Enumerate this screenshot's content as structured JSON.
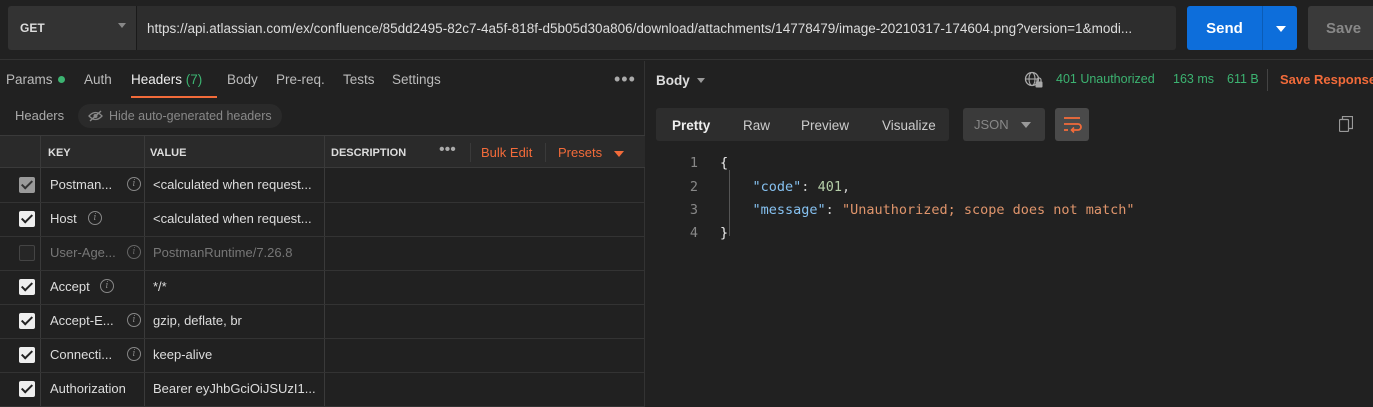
{
  "request": {
    "method": "GET",
    "url": "https://api.atlassian.com/ex/confluence/85dd2495-82c7-4a5f-818f-d5b05d30a806/download/attachments/14778479/image-20210317-174604.png?version=1&modi...",
    "send_label": "Send",
    "save_label": "Save"
  },
  "request_tabs": [
    {
      "label": "Params"
    },
    {
      "label": "Auth"
    },
    {
      "label": "Headers",
      "count": "(7)"
    },
    {
      "label": "Body"
    },
    {
      "label": "Pre-req."
    },
    {
      "label": "Tests"
    },
    {
      "label": "Settings"
    }
  ],
  "headers_section": {
    "label": "Headers",
    "hide_auto_label": "Hide auto-generated headers"
  },
  "table": {
    "columns": {
      "key": "KEY",
      "value": "VALUE",
      "description": "DESCRIPTION"
    },
    "bulk_edit": "Bulk Edit",
    "presets": "Presets",
    "rows": [
      {
        "key": "Postman...",
        "value": "<calculated when request...",
        "state": "gray"
      },
      {
        "key": "Host",
        "value": "<calculated when request...",
        "state": "on"
      },
      {
        "key": "User-Age...",
        "value": "PostmanRuntime/7.26.8",
        "state": "off"
      },
      {
        "key": "Accept",
        "value": "*/*",
        "state": "on"
      },
      {
        "key": "Accept-E...",
        "value": "gzip, deflate, br",
        "state": "on"
      },
      {
        "key": "Connecti...",
        "value": "keep-alive",
        "state": "on"
      },
      {
        "key": "Authorization",
        "value": "Bearer eyJhbGciOiJSUzI1...",
        "state": "on"
      }
    ]
  },
  "response": {
    "body_label": "Body",
    "status": "401 Unauthorized",
    "time": "163 ms",
    "size": "611 B",
    "save_response": "Save Response",
    "view_tabs": [
      "Pretty",
      "Raw",
      "Preview",
      "Visualize"
    ],
    "format": "JSON",
    "code_lines": [
      {
        "num": "1",
        "text": "{"
      },
      {
        "num": "2",
        "key": "\"code\"",
        "value": "401",
        "trail": ","
      },
      {
        "num": "3",
        "key": "\"message\"",
        "value": "\"Unauthorized; scope does not match\"",
        "trail": ""
      },
      {
        "num": "4",
        "text": "}"
      }
    ]
  },
  "colors": {
    "accent": "#f26b3a",
    "send_blue": "#0d6edb",
    "status_green": "#3cb371"
  }
}
